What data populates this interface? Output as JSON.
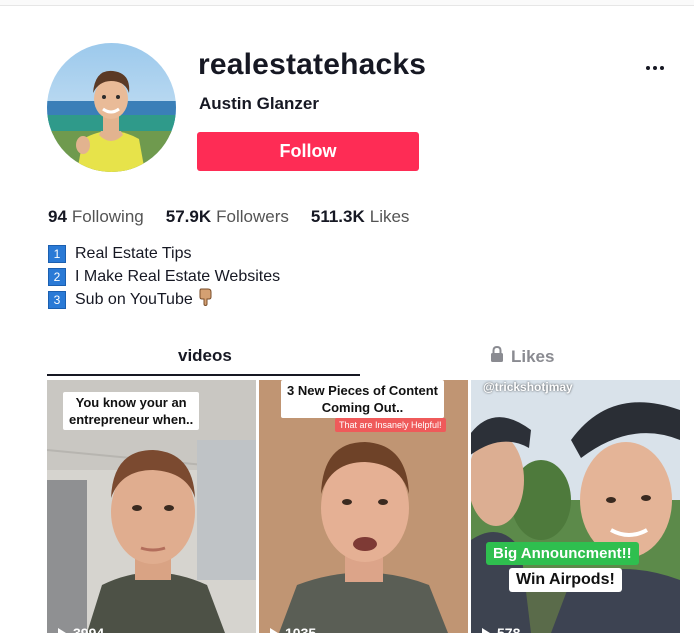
{
  "profile": {
    "username": "realestatehacks",
    "nickname": "Austin Glanzer",
    "follow_label": "Follow"
  },
  "stats": {
    "following_count": "94",
    "following_label": "Following",
    "followers_count": "57.9K",
    "followers_label": "Followers",
    "likes_count": "511.3K",
    "likes_label": "Likes"
  },
  "bio": [
    {
      "number": "1",
      "text": "Real Estate Tips"
    },
    {
      "number": "2",
      "text": "I Make Real Estate Websites"
    },
    {
      "number": "3",
      "text": "Sub on YouTube"
    }
  ],
  "tabs": {
    "videos": "videos",
    "likes": "Likes"
  },
  "videos": [
    {
      "caption": "You know your an\nentrepreneur when..",
      "views": "3994"
    },
    {
      "caption": "3 New Pieces of Content\nComing Out..",
      "tag": "That are Insanely Helpful!",
      "views": "1035"
    },
    {
      "handle": "@trickshotjmay",
      "tag1": "Big Announcment!!",
      "tag2": "Win Airpods!",
      "views": "578"
    }
  ],
  "colors": {
    "accent": "#fe2c55",
    "badge": "#2a7ad6",
    "text": "#161823",
    "muted": "#8a8b91"
  }
}
